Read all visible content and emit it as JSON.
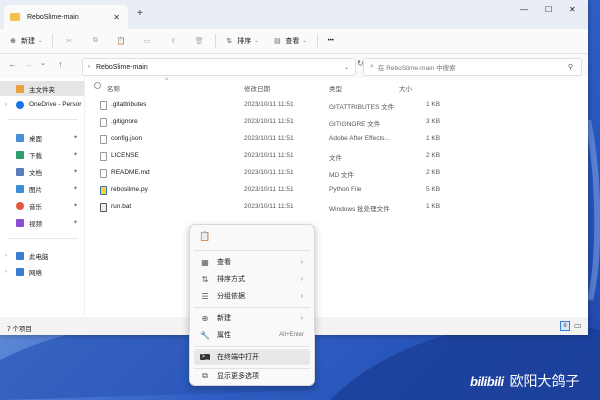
{
  "window": {
    "tab_title": "ReboSlime-main",
    "tab_close": "✕",
    "new_tab": "+",
    "controls": {
      "minimize": "—",
      "maximize": "☐",
      "close": "✕"
    }
  },
  "toolbar": {
    "new_label": "新建",
    "sort_label": "排序",
    "view_label": "查看",
    "more_label": "•••"
  },
  "address": {
    "path": "ReboSlime-main",
    "search_placeholder": "在 ReboSlime-main 中搜索"
  },
  "sidebar": {
    "items": [
      {
        "label": "主文件夹",
        "icon": "home-icon",
        "color": "#e8a33d"
      },
      {
        "label": "OneDrive - Persor",
        "icon": "cloud-icon",
        "color": "#1a73e8"
      },
      {
        "label": "桌面",
        "icon": "desktop-icon",
        "color": "#4a90d9"
      },
      {
        "label": "下载",
        "icon": "download-icon",
        "color": "#2e9e6b"
      },
      {
        "label": "文档",
        "icon": "documents-icon",
        "color": "#5b7db8"
      },
      {
        "label": "图片",
        "icon": "pictures-icon",
        "color": "#3b8fd6"
      },
      {
        "label": "音乐",
        "icon": "music-icon",
        "color": "#e4573d"
      },
      {
        "label": "视频",
        "icon": "videos-icon",
        "color": "#8a4fd1"
      },
      {
        "label": "此电脑",
        "icon": "computer-icon",
        "color": "#3a7bd5"
      },
      {
        "label": "网络",
        "icon": "network-icon",
        "color": "#3a7bd5"
      }
    ],
    "pin_glyph": "📌"
  },
  "columns": {
    "name": "名称",
    "modified": "修改日期",
    "type": "类型",
    "size": "大小"
  },
  "files": [
    {
      "name": ".gitattributes",
      "modified": "2023/10/11 11:51",
      "type": "GITATTRIBUTES 文件",
      "size": "1 KB"
    },
    {
      "name": ".gitignore",
      "modified": "2023/10/11 11:51",
      "type": "GITIGNORE 文件",
      "size": "3 KB"
    },
    {
      "name": "config.json",
      "modified": "2023/10/11 11:51",
      "type": "Adobe After Effects...",
      "size": "1 KB"
    },
    {
      "name": "LICENSE",
      "modified": "2023/10/11 11:51",
      "type": "文件",
      "size": "2 KB"
    },
    {
      "name": "README.md",
      "modified": "2023/10/11 11:51",
      "type": "MD 文件",
      "size": "2 KB"
    },
    {
      "name": "reboslime.py",
      "modified": "2023/10/11 11:51",
      "type": "Python File",
      "size": "5 KB"
    },
    {
      "name": "run.bat",
      "modified": "2023/10/11 11:51",
      "type": "Windows 批处理文件",
      "size": "1 KB"
    }
  ],
  "status": {
    "count": "7 个项目"
  },
  "context_menu": {
    "items": [
      {
        "label": "查看",
        "icon": "grid-icon",
        "submenu": true
      },
      {
        "label": "排序方式",
        "icon": "sort-icon",
        "submenu": true
      },
      {
        "label": "分组依据",
        "icon": "group-icon",
        "submenu": true
      },
      {
        "label": "新建",
        "icon": "plus-circle-icon",
        "submenu": true
      },
      {
        "label": "属性",
        "icon": "wrench-icon",
        "shortcut": "Alt+Enter"
      },
      {
        "label": "在终端中打开",
        "icon": "terminal-icon",
        "highlight": true
      },
      {
        "label": "显示更多选项",
        "icon": "more-options-icon"
      }
    ]
  },
  "watermark": {
    "logo": "bilibili",
    "author": "欧阳大鸽子"
  }
}
